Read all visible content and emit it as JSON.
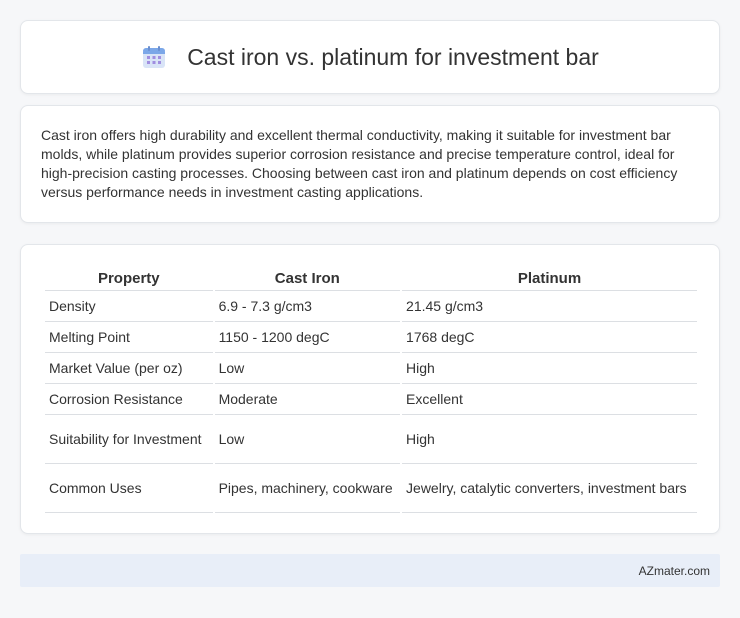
{
  "header": {
    "title": "Cast iron vs. platinum for investment bar",
    "icon": "calendar-icon"
  },
  "intro": {
    "text": "Cast iron offers high durability and excellent thermal conductivity, making it suitable for investment bar molds, while platinum provides superior corrosion resistance and precise temperature control, ideal for high-precision casting processes. Choosing between cast iron and platinum depends on cost efficiency versus performance needs in investment casting applications."
  },
  "table": {
    "headers": [
      "Property",
      "Cast Iron",
      "Platinum"
    ],
    "rows": [
      [
        "Density",
        "6.9 - 7.3 g/cm3",
        "21.45 g/cm3"
      ],
      [
        "Melting Point",
        "1150 - 1200 degC",
        "1768 degC"
      ],
      [
        "Market Value (per oz)",
        "Low",
        "High"
      ],
      [
        "Corrosion Resistance",
        "Moderate",
        "Excellent"
      ],
      [
        "Suitability for Investment",
        "Low",
        "High"
      ],
      [
        "Common Uses",
        "Pipes, machinery, cookware",
        "Jewelry, catalytic converters, investment bars"
      ]
    ]
  },
  "footer": {
    "text": "AZmater.com"
  },
  "colors": {
    "icon_blue": "#7ba7e8",
    "icon_purple": "#a08ee0",
    "footer_bg": "#e8eef8"
  }
}
